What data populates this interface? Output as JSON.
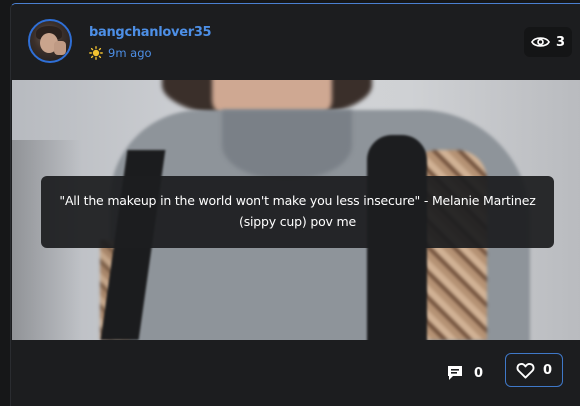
{
  "post": {
    "author": {
      "username": "bangchanlover35",
      "time_ago": "9m ago"
    },
    "views": {
      "icon": "eye-icon",
      "count": "3"
    },
    "caption": "\"All the makeup in the world won't make you less insecure\" - Melanie Martinez (sippy cup) pov me",
    "image": {
      "description_icon": "post-photo"
    },
    "actions": {
      "comments": {
        "icon": "comment-icon",
        "count": "0"
      },
      "likes": {
        "icon": "heart-icon",
        "count": "0"
      }
    }
  },
  "colors": {
    "accent": "#4d8fe6",
    "card_bg": "#1c1d1f",
    "page_bg": "#161718",
    "border_accent": "#3f78c8"
  }
}
